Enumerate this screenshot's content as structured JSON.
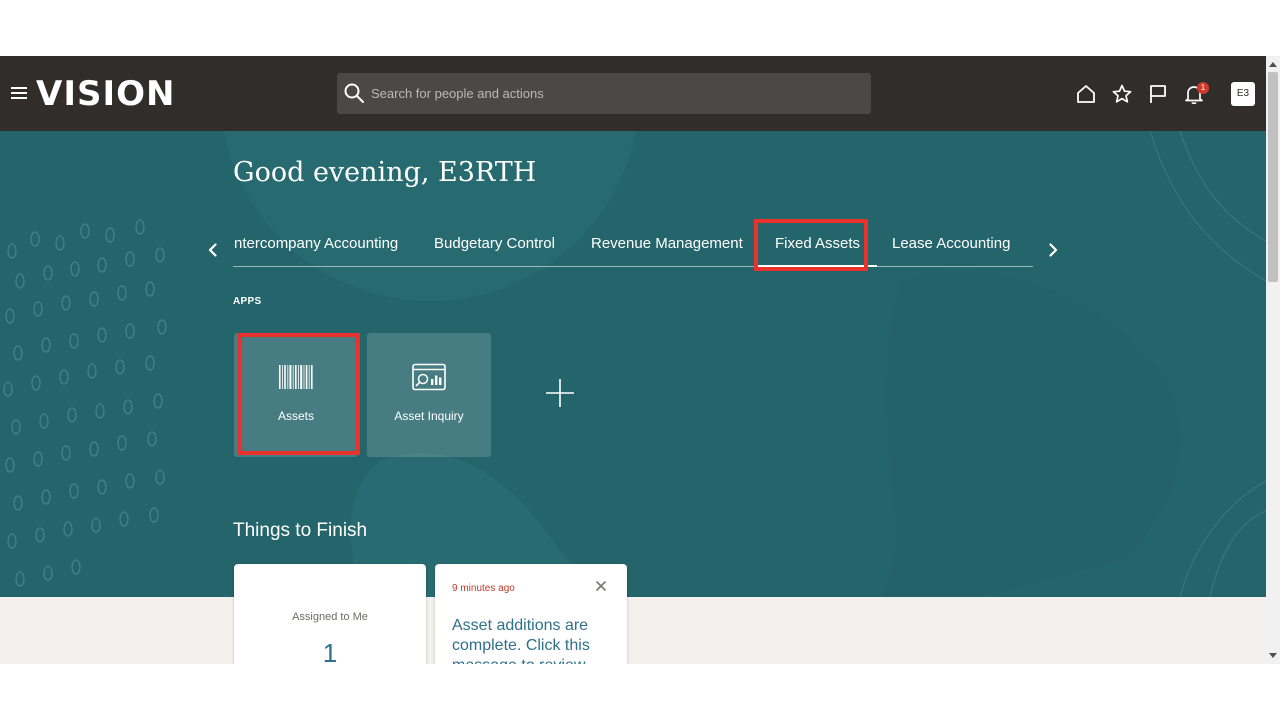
{
  "header": {
    "logo": "VISION",
    "search_placeholder": "Search for people and actions",
    "notification_count": "1",
    "avatar_initials": "E3",
    "icons": [
      "menu-icon",
      "search-icon",
      "home-icon",
      "star-icon",
      "flag-icon",
      "bell-icon"
    ]
  },
  "hero": {
    "greeting": "Good evening, E3RTH",
    "tabs": [
      {
        "label": "ntercompany Accounting"
      },
      {
        "label": "Budgetary Control"
      },
      {
        "label": "Revenue Management"
      },
      {
        "label": "Fixed Assets",
        "selected": true
      },
      {
        "label": "Lease Accounting"
      }
    ],
    "apps_heading": "APPS",
    "apps": [
      {
        "label": "Assets",
        "icon": "barcode-icon"
      },
      {
        "label": "Asset Inquiry",
        "icon": "asset-inquiry-icon"
      }
    ],
    "add_icon": "plus-icon",
    "things_heading": "Things to Finish"
  },
  "cards": {
    "assigned": {
      "label": "Assigned to Me",
      "count": "1"
    },
    "notification": {
      "time": "9 minutes ago",
      "message": "Asset additions are complete. Click this message to review"
    }
  },
  "colors": {
    "header_bg": "#312d2a",
    "hero_bg": "#24656b",
    "highlight": "#e8322b",
    "link_blue": "#2f7189",
    "alert_red": "#c23a2b"
  }
}
